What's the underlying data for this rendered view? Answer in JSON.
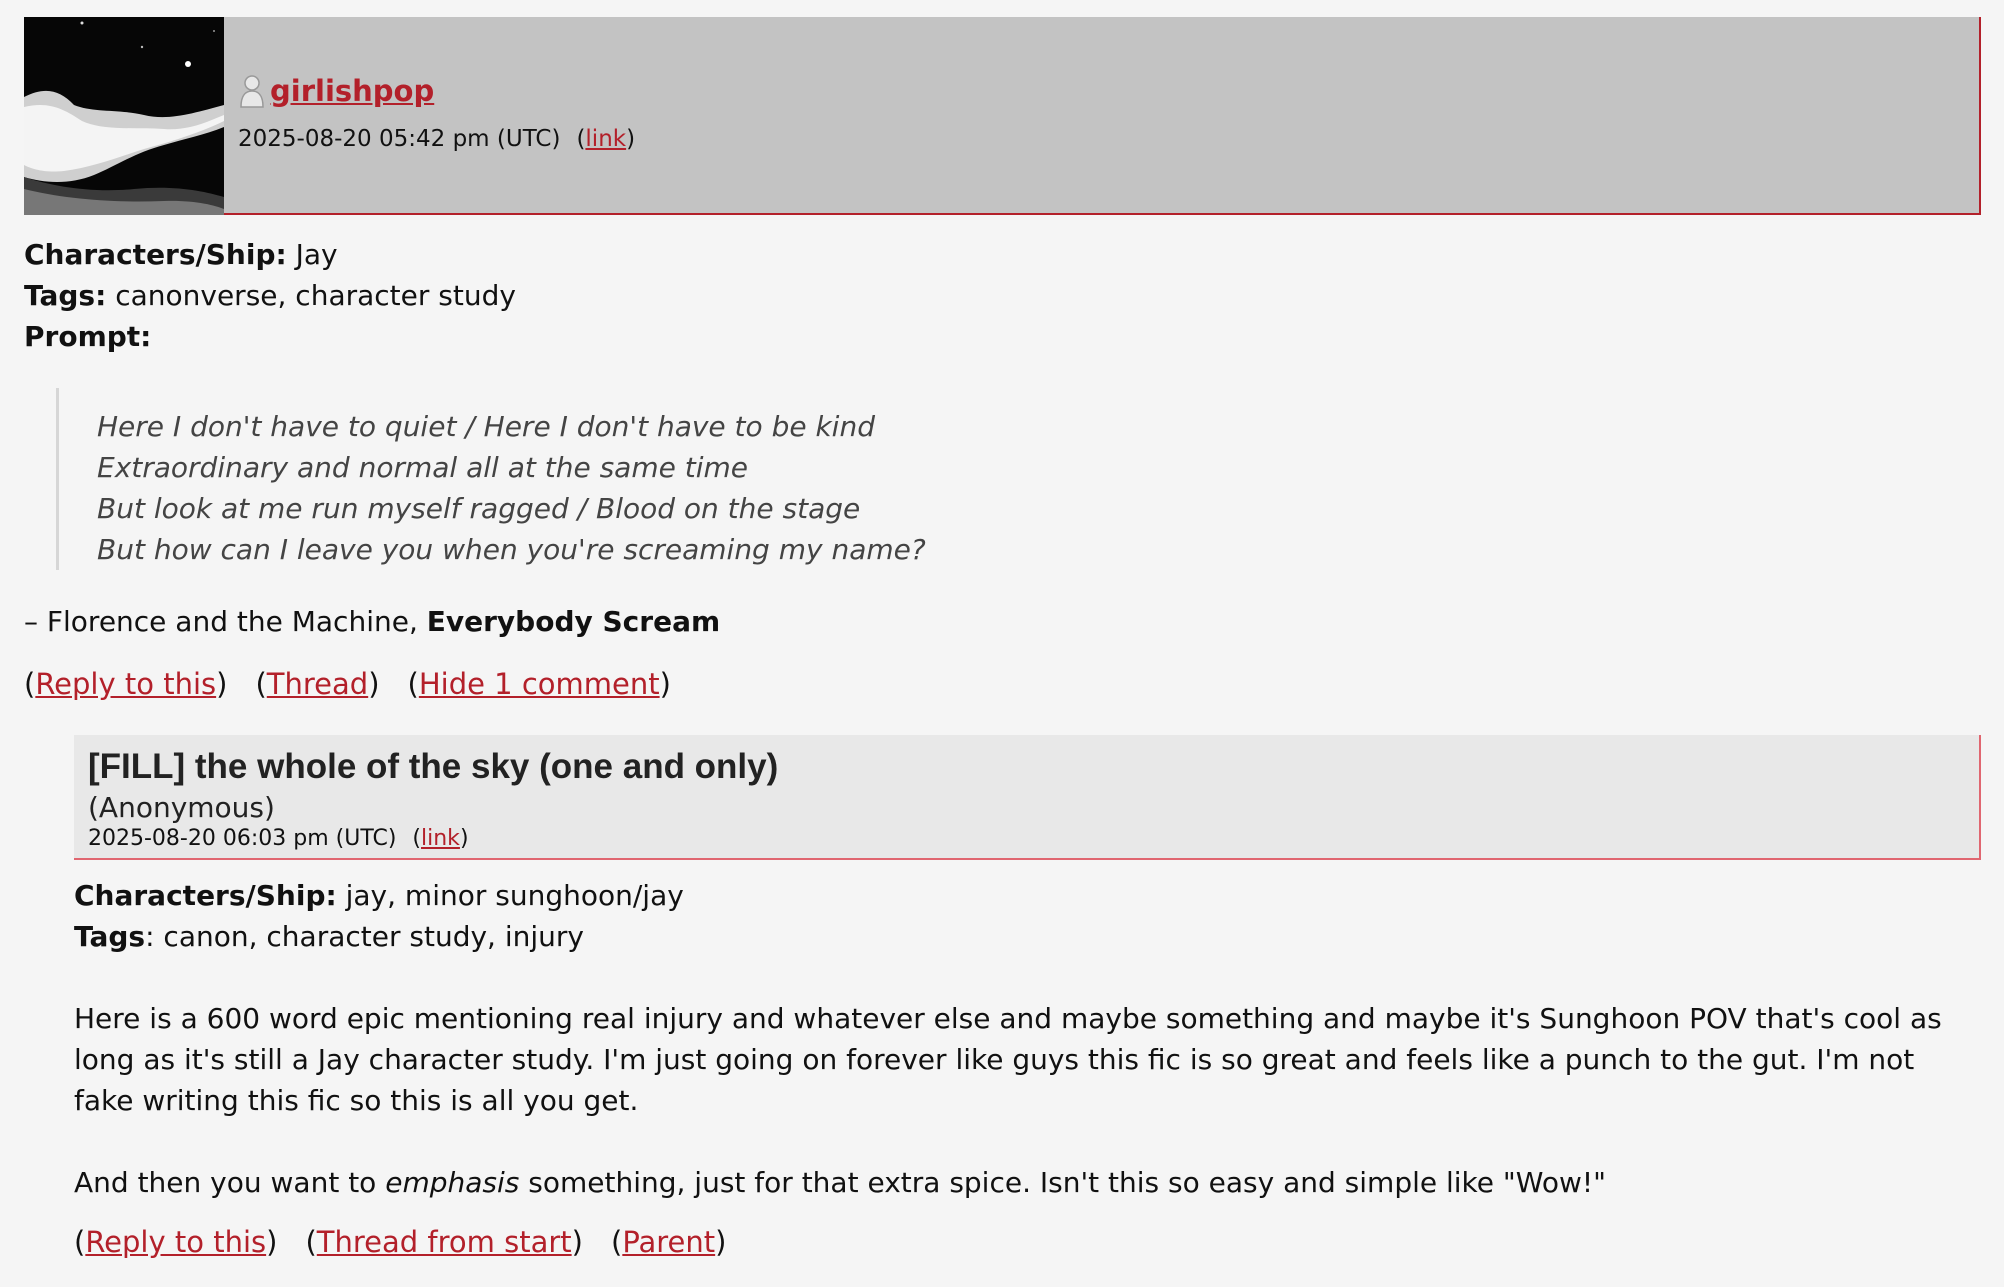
{
  "top_comment": {
    "username": "girlishpop",
    "date": "2025-08-20 05:42 pm (UTC)",
    "link_label": "link",
    "characters_label": "Characters/Ship:",
    "characters_value": "Jay",
    "tags_label": "Tags:",
    "tags_value": "canonverse, character study",
    "prompt_label": "Prompt:",
    "quote_lines": [
      "Here I don't have to quiet / Here I don't have to be kind",
      "Extraordinary and normal all at the same time",
      "But look at me run myself ragged / Blood on the stage",
      "But how can I leave you when you're screaming my name?"
    ],
    "attribution_prefix": "– Florence and the Machine, ",
    "attribution_title": "Everybody Scream",
    "actions": {
      "reply": "Reply to this",
      "thread": "Thread",
      "hide": "Hide 1 comment"
    }
  },
  "reply": {
    "title": "[FILL] the whole of the sky (one and only)",
    "poster": "(Anonymous)",
    "date": "2025-08-20 06:03 pm (UTC)",
    "link_label": "link",
    "characters_label": "Characters/Ship:",
    "characters_value": "jay, minor sunghoon/jay",
    "tags_label": "Tags",
    "tags_value": ": canon, character study, injury",
    "paragraph1": "Here is a 600 word epic mentioning real injury and whatever else and maybe something and maybe it's Sunghoon POV that's cool as long as it's still a Jay character study. I'm just going on forever like guys this fic is so great and feels like a punch to the gut. I'm not fake writing this fic so this is all you get.",
    "paragraph2_before": "And then you want to ",
    "paragraph2_emphasis": "emphasis",
    "paragraph2_after": " something, just for that extra spice. Isn't this so easy and simple like \"Wow!\"",
    "actions": {
      "reply": "Reply to this",
      "thread_from_start": "Thread from start",
      "parent": "Parent"
    }
  },
  "colors": {
    "link": "#b3202a",
    "header_bg": "#c3c3c3",
    "reply_header_bg": "#e8e8e8"
  }
}
